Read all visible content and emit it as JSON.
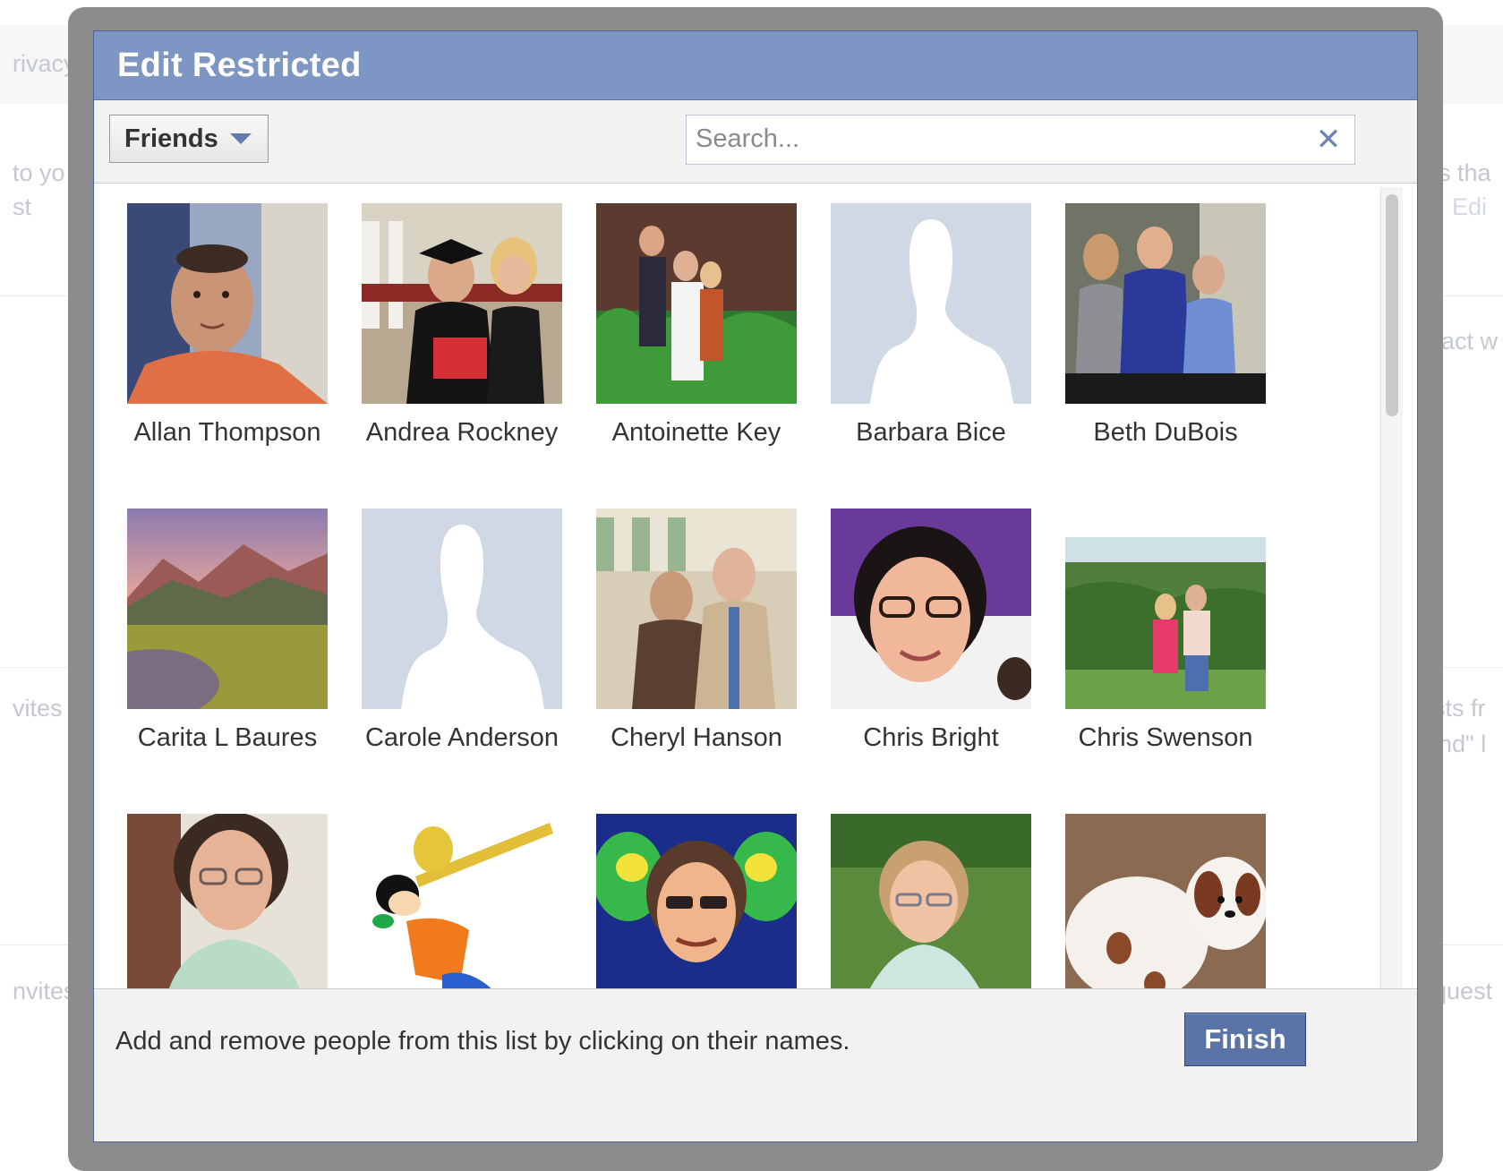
{
  "background_fragments": {
    "left": [
      "rivacy",
      "to yo",
      "st",
      "vites",
      "nvites"
    ],
    "right": [
      "sts tha",
      "st. Edi",
      "eract w",
      "ests fr",
      "iend\" l",
      "equest"
    ]
  },
  "dialog": {
    "title": "Edit Restricted",
    "filter": {
      "selected": "Friends"
    },
    "search": {
      "placeholder": "Search...",
      "value": "",
      "clear_icon": "close-icon"
    },
    "footer": {
      "hint": "Add and remove people from this list by clicking on their names.",
      "finish_label": "Finish"
    }
  },
  "friends": [
    {
      "name": "Allan Thompson",
      "photo": "portrait-man-orange-shirt"
    },
    {
      "name": "Andrea Rockney",
      "photo": "graduation-photo"
    },
    {
      "name": "Antoinette Key",
      "photo": "family-outdoors"
    },
    {
      "name": "Barbara Bice",
      "photo": "default-silhouette"
    },
    {
      "name": "Beth DuBois",
      "photo": "group-indoors"
    },
    {
      "name": "Carita L Baures",
      "photo": "mountain-landscape"
    },
    {
      "name": "Carole Anderson",
      "photo": "default-silhouette"
    },
    {
      "name": "Cheryl Hanson",
      "photo": "couple-restaurant"
    },
    {
      "name": "Chris Bright",
      "photo": "woman-closeup"
    },
    {
      "name": "Chris Swenson",
      "photo": "couple-hillside"
    },
    {
      "name": "",
      "photo": "woman-glasses"
    },
    {
      "name": "",
      "photo": "cartoon-trombone"
    },
    {
      "name": "",
      "photo": "woman-phone-colorful"
    },
    {
      "name": "",
      "photo": "woman-outdoors-grass"
    },
    {
      "name": "",
      "photo": "fluffy-puppy"
    }
  ],
  "colors": {
    "header_blue": "#7d96c3",
    "finish_blue": "#5b74a8",
    "silhouette_bg": "#d0d7e5"
  }
}
